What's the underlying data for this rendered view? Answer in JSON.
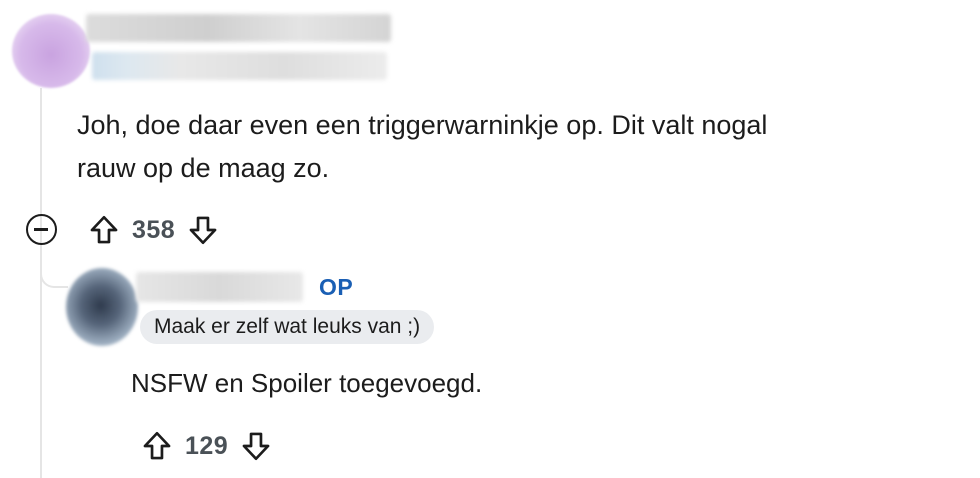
{
  "comment": {
    "body_line_1": "Joh, doe daar even een triggerwarninkje op. Dit valt nogal",
    "body_line_2": "rauw op de maag zo.",
    "score": "358",
    "icons": {
      "collapse": "collapse-icon",
      "upvote": "upvote-icon",
      "downvote": "downvote-icon"
    }
  },
  "reply": {
    "badge": "OP",
    "flair": "Maak er zelf wat leuks van ;)",
    "body": "NSFW en Spoiler toegevoegd.",
    "score": "129",
    "icons": {
      "upvote": "upvote-icon",
      "downvote": "downvote-icon"
    }
  }
}
